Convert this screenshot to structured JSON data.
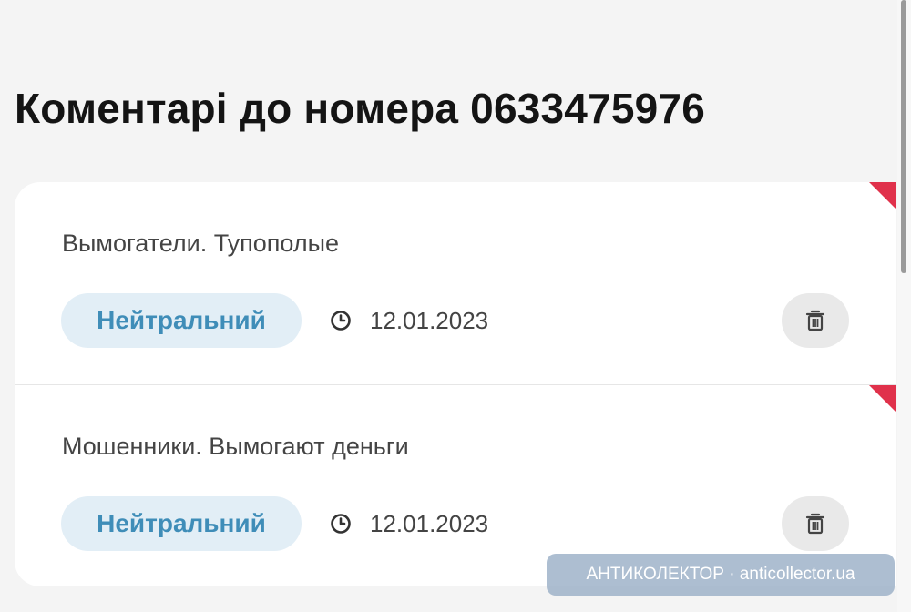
{
  "title": "Коментарі до номера 0633475976",
  "comments": [
    {
      "text": "Вымогатели. Тупополые",
      "badge": "Нейтральний",
      "date": "12.01.2023"
    },
    {
      "text": "Мошенники. Вымогают деньги",
      "badge": "Нейтральний",
      "date": "12.01.2023"
    }
  ],
  "icons": {
    "date": "clock-icon",
    "delete": "trash-icon"
  },
  "colors": {
    "badge_bg": "#e2eef6",
    "badge_text": "#3f8db8",
    "flag": "#e0314b"
  },
  "watermark": "АНТИКОЛЕКТОР · anticollector.ua"
}
